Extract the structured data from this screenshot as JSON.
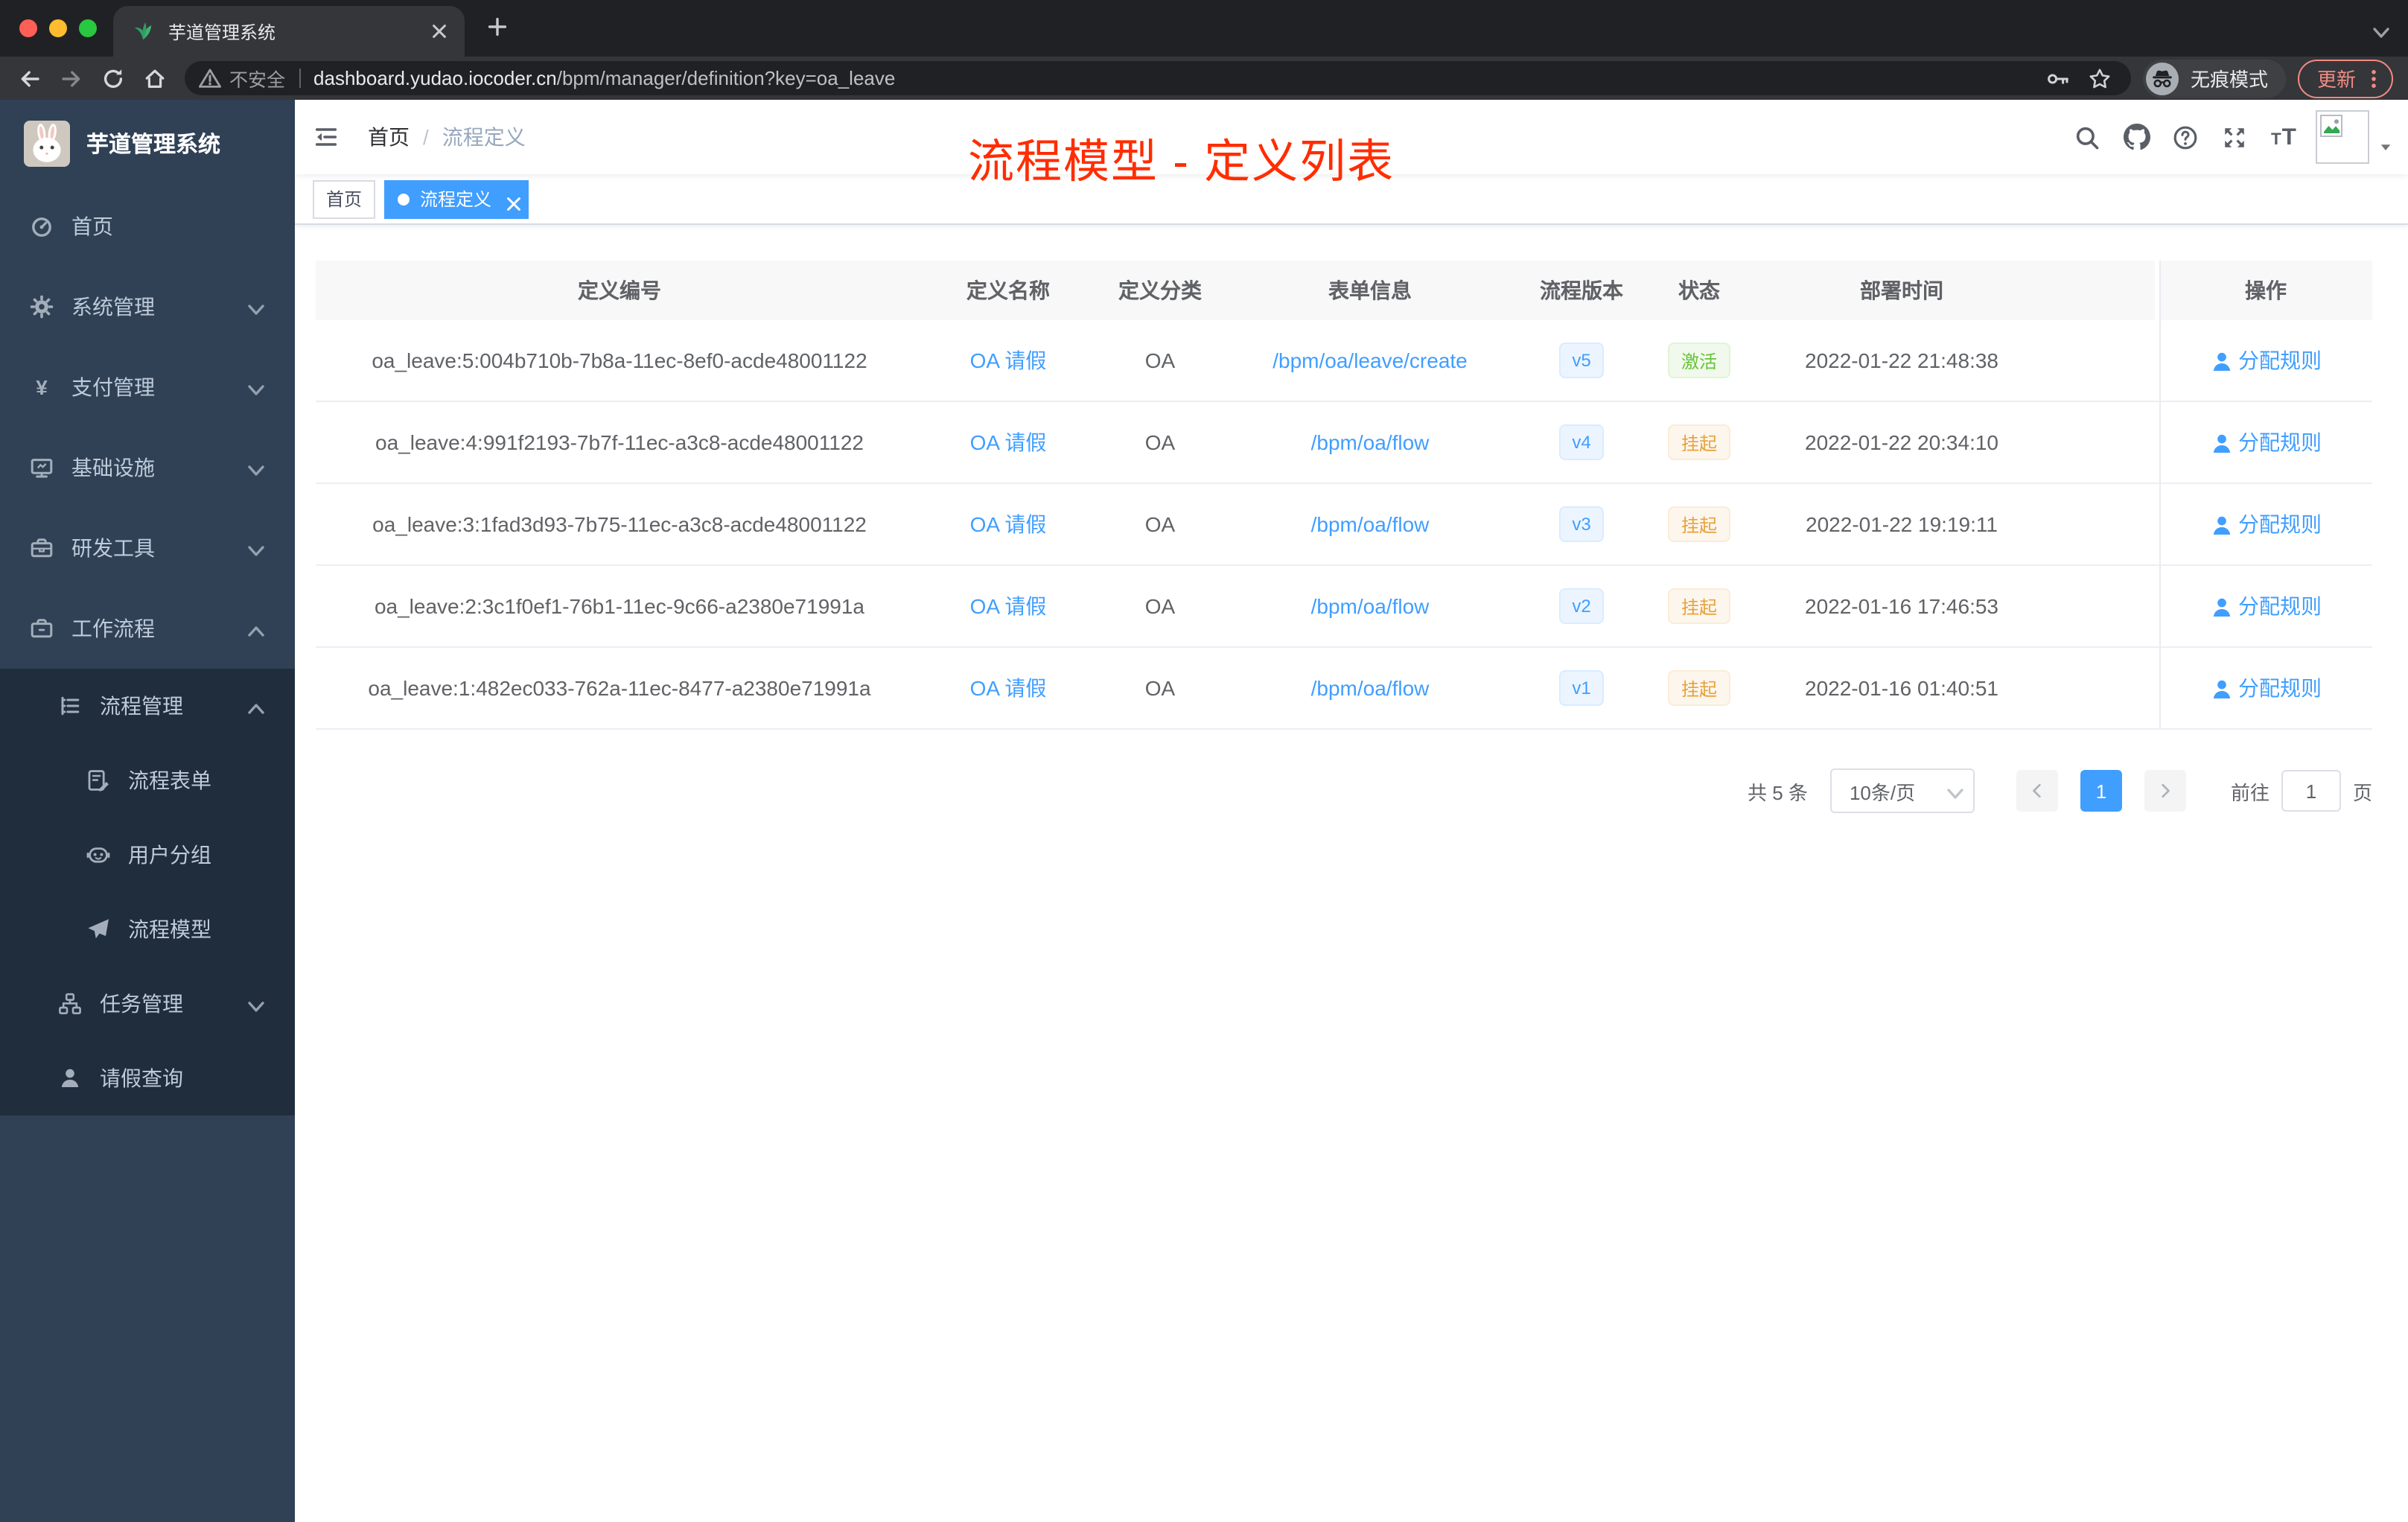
{
  "browser": {
    "tab_title": "芋道管理系统",
    "security_label": "不安全",
    "url_host": "dashboard.yudao.iocoder.cn",
    "url_path": "/bpm/manager/definition?key=oa_leave",
    "incognito_label": "无痕模式",
    "update_label": "更新"
  },
  "sidebar": {
    "logo_title": "芋道管理系统",
    "items": [
      {
        "name": "home",
        "label": "首页",
        "icon": "dashboard",
        "level": 1
      },
      {
        "name": "system-admin",
        "label": "系统管理",
        "icon": "gear",
        "level": 1,
        "chevron": "down"
      },
      {
        "name": "payment-admin",
        "label": "支付管理",
        "icon": "yen",
        "level": 1,
        "chevron": "down"
      },
      {
        "name": "infrastructure",
        "label": "基础设施",
        "icon": "monitor",
        "level": 1,
        "chevron": "down"
      },
      {
        "name": "dev-tools",
        "label": "研发工具",
        "icon": "toolbox",
        "level": 1,
        "chevron": "down"
      },
      {
        "name": "workflow",
        "label": "工作流程",
        "icon": "briefcase",
        "level": 1,
        "chevron": "up"
      },
      {
        "name": "process-admin",
        "label": "流程管理",
        "icon": "listtree",
        "level": 2,
        "chevron": "up",
        "dark": true
      },
      {
        "name": "process-form",
        "label": "流程表单",
        "icon": "form",
        "level": 3,
        "dark": true
      },
      {
        "name": "user-group",
        "label": "用户分组",
        "icon": "robot",
        "level": 3,
        "dark": true
      },
      {
        "name": "process-model",
        "label": "流程模型",
        "icon": "plane",
        "level": 3,
        "dark": true
      },
      {
        "name": "task-admin",
        "label": "任务管理",
        "icon": "tree",
        "level": 2,
        "chevron": "down",
        "dark": true
      },
      {
        "name": "leave-query",
        "label": "请假查询",
        "icon": "user",
        "level": 2,
        "dark": true
      }
    ]
  },
  "header": {
    "breadcrumb_home": "首页",
    "breadcrumb_current": "流程定义",
    "annotation": "流程模型 - 定义列表"
  },
  "tags": [
    {
      "name": "home",
      "label": "首页",
      "active": false
    },
    {
      "name": "process-definition",
      "label": "流程定义",
      "active": true
    }
  ],
  "table": {
    "columns": [
      "定义编号",
      "定义名称",
      "定义分类",
      "表单信息",
      "流程版本",
      "状态",
      "部署时间",
      "操作"
    ],
    "rows": [
      {
        "id": "oa_leave:5:004b710b-7b8a-11ec-8ef0-acde48001122",
        "name": "OA 请假",
        "category": "OA",
        "form": "/bpm/oa/leave/create",
        "version": "v5",
        "status": "激活",
        "status_type": "success",
        "time": "2022-01-22 21:48:38",
        "action": "分配规则"
      },
      {
        "id": "oa_leave:4:991f2193-7b7f-11ec-a3c8-acde48001122",
        "name": "OA 请假",
        "category": "OA",
        "form": "/bpm/oa/flow",
        "version": "v4",
        "status": "挂起",
        "status_type": "warning",
        "time": "2022-01-22 20:34:10",
        "action": "分配规则"
      },
      {
        "id": "oa_leave:3:1fad3d93-7b75-11ec-a3c8-acde48001122",
        "name": "OA 请假",
        "category": "OA",
        "form": "/bpm/oa/flow",
        "version": "v3",
        "status": "挂起",
        "status_type": "warning",
        "time": "2022-01-22 19:19:11",
        "action": "分配规则"
      },
      {
        "id": "oa_leave:2:3c1f0ef1-76b1-11ec-9c66-a2380e71991a",
        "name": "OA 请假",
        "category": "OA",
        "form": "/bpm/oa/flow",
        "version": "v2",
        "status": "挂起",
        "status_type": "warning",
        "time": "2022-01-16 17:46:53",
        "action": "分配规则"
      },
      {
        "id": "oa_leave:1:482ec033-762a-11ec-8477-a2380e71991a",
        "name": "OA 请假",
        "category": "OA",
        "form": "/bpm/oa/flow",
        "version": "v1",
        "status": "挂起",
        "status_type": "warning",
        "time": "2022-01-16 01:40:51",
        "action": "分配规则"
      }
    ]
  },
  "pagination": {
    "total": "共 5 条",
    "page_size": "10条/页",
    "current_page": "1",
    "goto_label": "前往",
    "goto_value": "1",
    "unit_label": "页"
  },
  "colors": {
    "accent": "#409eff",
    "success": "#67c23a",
    "warning": "#e6a23c",
    "annotation_red": "#ff2d00",
    "sidebar_bg": "#304156",
    "sidebar_submenu_bg": "#1f2d3d"
  }
}
